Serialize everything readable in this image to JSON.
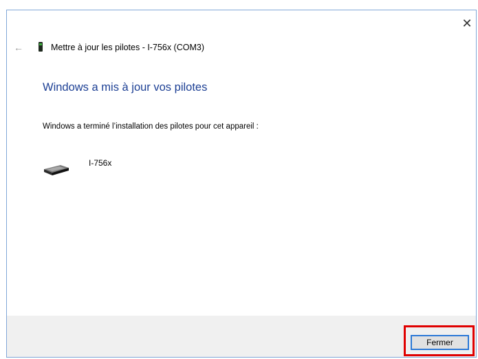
{
  "window": {
    "close_glyph": "✕"
  },
  "header": {
    "back_glyph": "←",
    "title": "Mettre à jour les pilotes - I-756x (COM3)",
    "device_icon": "device-small-icon"
  },
  "main": {
    "title": "Windows a mis à jour vos pilotes",
    "description": "Windows a terminé l’installation des pilotes pour cet appareil :",
    "device": {
      "name": "I-756x",
      "icon": "usb-serial-device-icon"
    }
  },
  "footer": {
    "close_button_label": "Fermer"
  },
  "colors": {
    "title_blue": "#1c3f94",
    "window_border": "#7fa6d8",
    "footer_bg": "#f0f0f0",
    "highlight_red": "#e00000",
    "button_focus_border": "#2a78d6"
  }
}
